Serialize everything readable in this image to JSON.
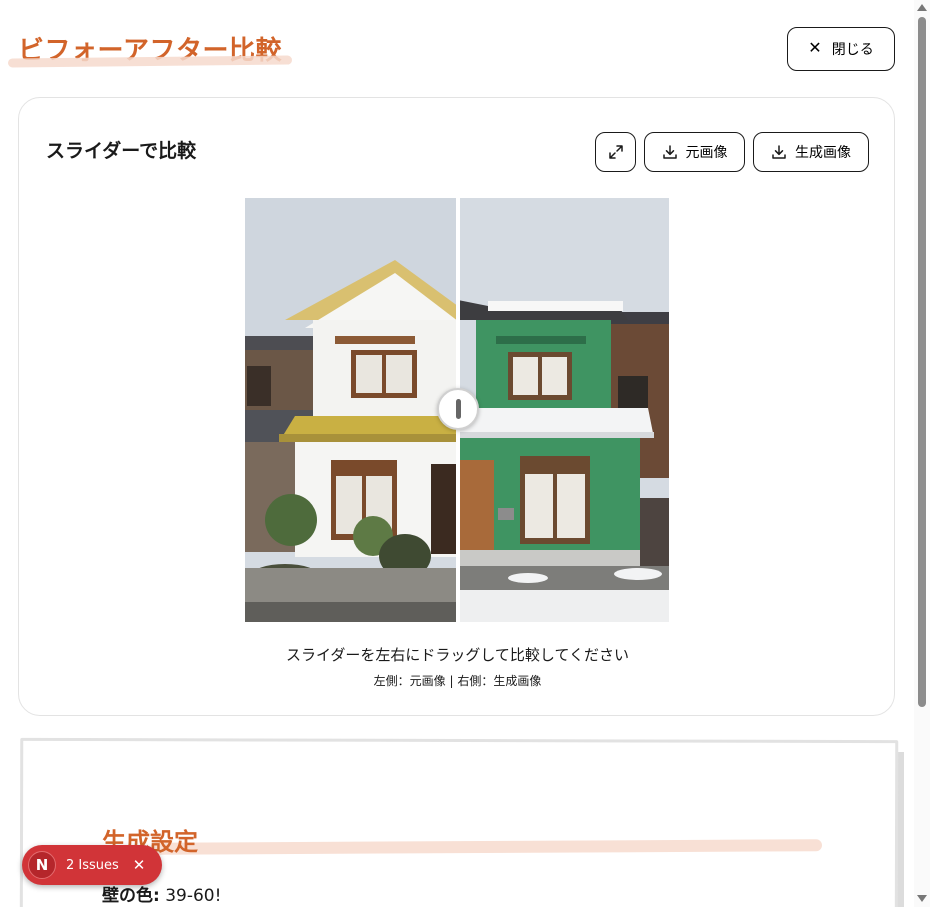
{
  "header": {
    "title": "ビフォーアフター比較",
    "close_label": "閉じる"
  },
  "compare_card": {
    "title": "スライダーで比較",
    "download_original_label": "元画像",
    "download_generated_label": "生成画像",
    "hint": "スライダーを左右にドラッグして比較してください",
    "legend": "左側：元画像 | 右側：生成画像",
    "slider_position_fraction": 0.5
  },
  "settings": {
    "title": "生成設定",
    "wall_color_label": "壁の色:",
    "wall_color_value": "39-60!"
  },
  "issues_badge": {
    "letter": "N",
    "label": "2 Issues"
  },
  "colors": {
    "accent": "#d2642a",
    "accent_underline": "#f6d9cc",
    "issues_red": "#d13438",
    "original_wall": "#f4f4f2",
    "generated_wall": "#3f9462",
    "roof_gold": "#c9b043"
  },
  "icons": {
    "close": "close-icon",
    "expand": "expand-icon",
    "download": "download-icon",
    "issues_close": "close-icon"
  }
}
